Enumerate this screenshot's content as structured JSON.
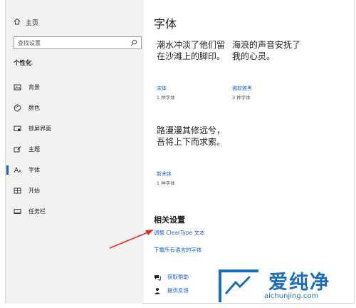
{
  "sidebar": {
    "home_label": "主页",
    "search_placeholder": "查找设置",
    "section_title": "个性化",
    "items": [
      {
        "label": "背景",
        "icon": "image-icon"
      },
      {
        "label": "颜色",
        "icon": "palette-icon"
      },
      {
        "label": "锁屏界面",
        "icon": "lock-screen-icon"
      },
      {
        "label": "主题",
        "icon": "brush-icon"
      },
      {
        "label": "字体",
        "icon": "font-icon",
        "active": true
      },
      {
        "label": "开始",
        "icon": "start-icon"
      },
      {
        "label": "任务栏",
        "icon": "taskbar-icon"
      }
    ]
  },
  "main": {
    "title": "字体",
    "fonts": [
      {
        "preview": "潮水冲淡了他们留在沙滩上的脚印。",
        "name": "宋体",
        "count": "1 种字体"
      },
      {
        "preview": "海浪的声音安抚了我的心灵。",
        "name": "微软雅黑",
        "count": "3 种字体"
      },
      {
        "preview": "路漫漫其修远兮，吾将上下而求索。",
        "name": "新宋体",
        "count": "1 种字体"
      }
    ],
    "related_title": "相关设置",
    "link_cleartype": "调整 ClearType 文本",
    "link_download": "下载所有语言的字体",
    "help_label": "获取帮助",
    "feedback_label": "提供反馈"
  },
  "watermark": {
    "big": "爱纯净",
    "small": "aichunjing.com"
  },
  "colors": {
    "accent": "#1a64c8",
    "arrow": "#e0302a",
    "watermark": "#1a6fb8"
  }
}
